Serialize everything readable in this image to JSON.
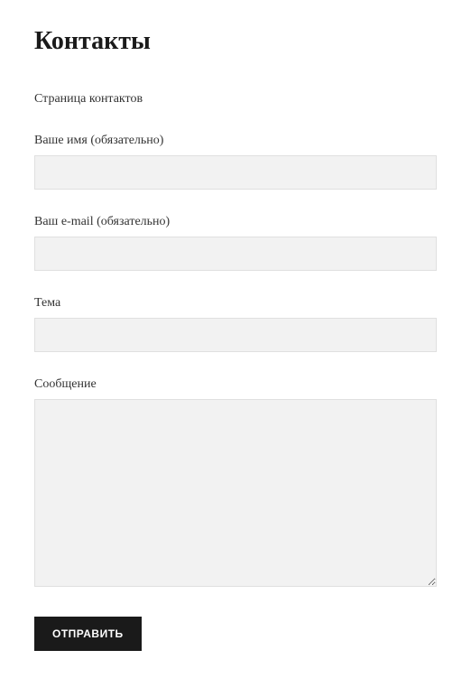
{
  "page": {
    "title": "Контакты",
    "description": "Страница контактов"
  },
  "form": {
    "name": {
      "label": "Ваше имя (обязательно)",
      "value": ""
    },
    "email": {
      "label": "Ваш e-mail (обязательно)",
      "value": ""
    },
    "subject": {
      "label": "Тема",
      "value": ""
    },
    "message": {
      "label": "Сообщение",
      "value": ""
    },
    "submit": {
      "label": "ОТПРАВИТЬ"
    }
  }
}
